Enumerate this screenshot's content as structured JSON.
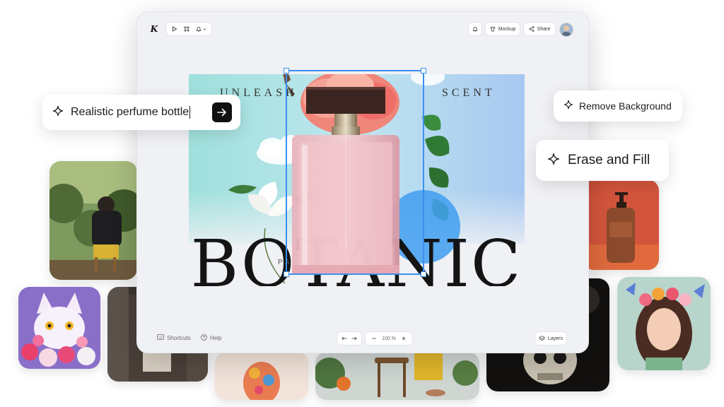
{
  "toolbar": {
    "logo": "K",
    "mockup_label": "Mockup",
    "share_label": "Share"
  },
  "canvas": {
    "headline_left": "UNLEASH",
    "headline_right": "SCENT",
    "brand_word": "BOTANIC",
    "sub_word": "PA"
  },
  "prompt": {
    "text": "Realistic perfume bottle"
  },
  "actions": {
    "remove_bg": "Remove Background",
    "erase_fill": "Erase and Fill"
  },
  "footer": {
    "shortcuts_label": "Shortcuts",
    "help_label": "Help",
    "zoom_level": "100 %",
    "layers_label": "Layers"
  },
  "colors": {
    "selection": "#3b8ff0",
    "accent_dark": "#111111"
  }
}
